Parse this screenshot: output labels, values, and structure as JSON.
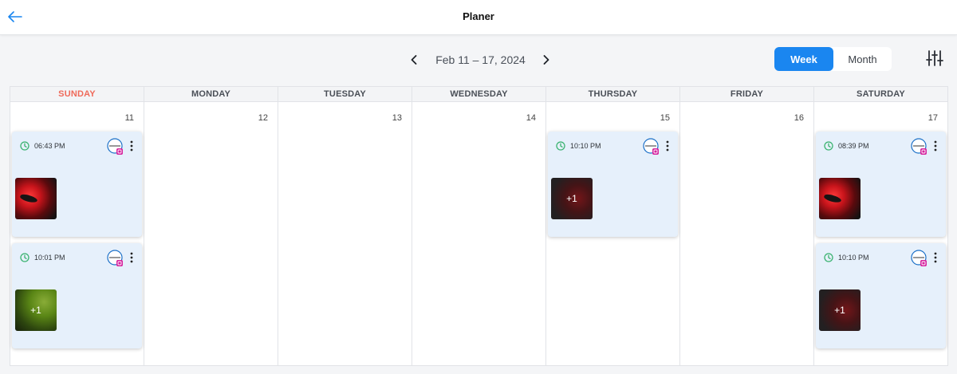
{
  "header": {
    "title": "Planer"
  },
  "toolbar": {
    "date_range": "Feb 11 – 17, 2024",
    "views": {
      "week": "Week",
      "month": "Month"
    },
    "active_view": "Week"
  },
  "colors": {
    "accent": "#1a86f0",
    "sunday": "#ef6a5a",
    "card_bg": "#e6f0fb",
    "clock": "#3cb371"
  },
  "days": [
    {
      "name": "SUNDAY",
      "num": "11"
    },
    {
      "name": "MONDAY",
      "num": "12"
    },
    {
      "name": "TUESDAY",
      "num": "13"
    },
    {
      "name": "WEDNESDAY",
      "num": "14"
    },
    {
      "name": "THURSDAY",
      "num": "15"
    },
    {
      "name": "FRIDAY",
      "num": "16"
    },
    {
      "name": "SATURDAY",
      "num": "17"
    }
  ],
  "posts": {
    "sunday_1": {
      "time": "06:43 PM",
      "extra": ""
    },
    "sunday_2": {
      "time": "10:01 PM",
      "extra": "+1"
    },
    "thursday_1": {
      "time": "10:10 PM",
      "extra": "+1"
    },
    "saturday_1": {
      "time": "08:39 PM",
      "extra": ""
    },
    "saturday_2": {
      "time": "10:10 PM",
      "extra": "+1"
    }
  }
}
